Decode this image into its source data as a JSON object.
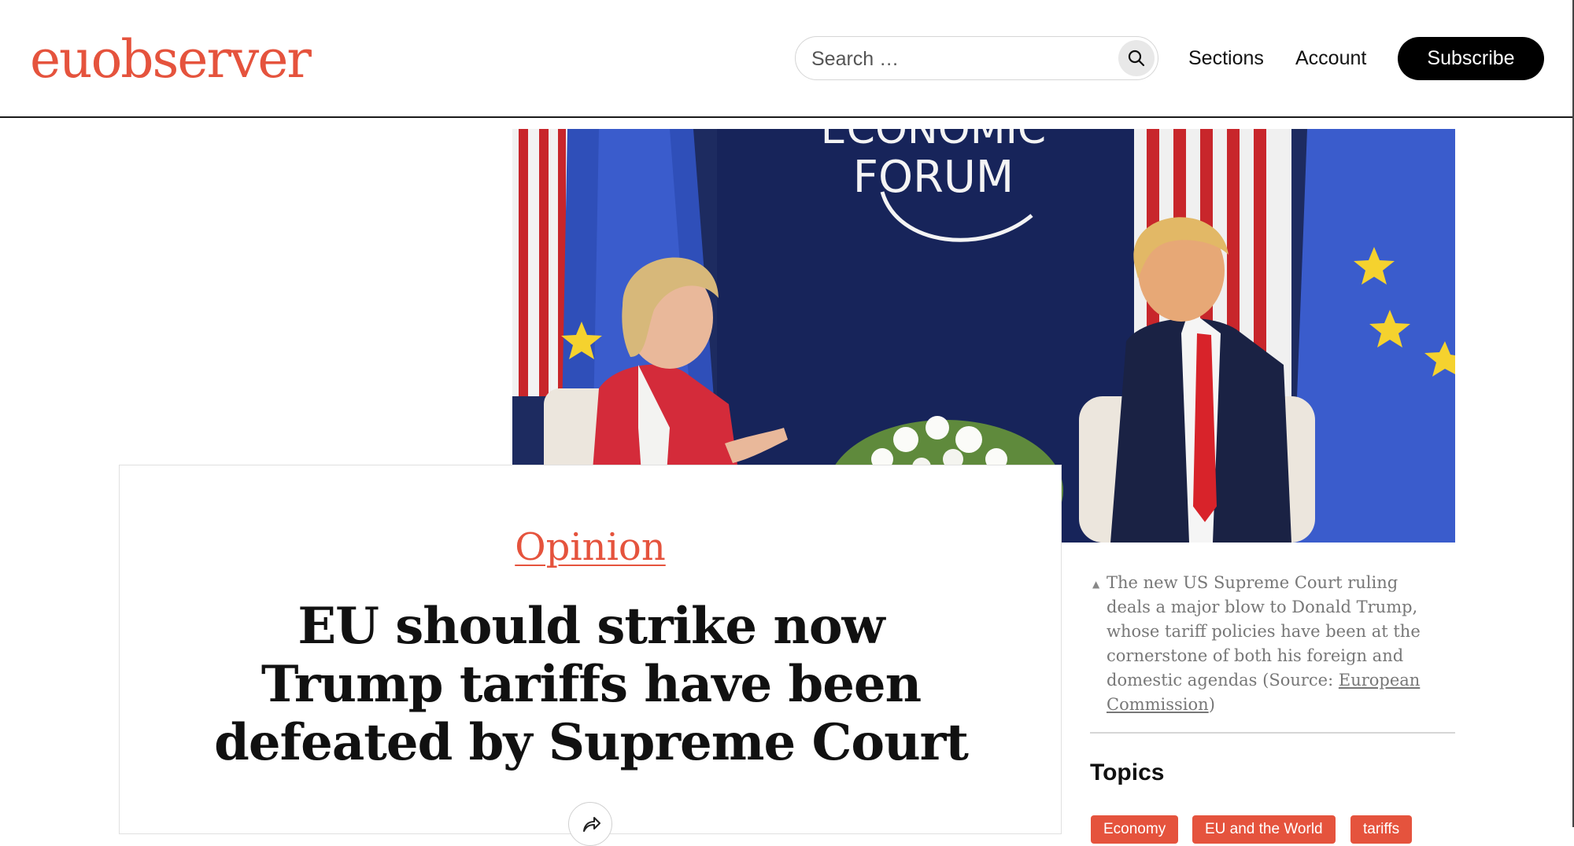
{
  "header": {
    "logo": "euobserver",
    "search_placeholder": "Search …",
    "nav": {
      "sections": "Sections",
      "account": "Account"
    },
    "subscribe_label": "Subscribe"
  },
  "hero": {
    "backdrop_text": [
      "ECONOMIC",
      "FORUM"
    ]
  },
  "article": {
    "category": "Opinion",
    "headline": "EU should strike now Trump tariffs have been defeated by Supreme Court",
    "caption": "The new US Supreme Court ruling deals a major blow to Donald Trump, whose tariff policies have been at the cornerstone of both his foreign and domestic agendas (Source: ",
    "caption_link": "European Commission",
    "caption_end": ")"
  },
  "topics": {
    "title": "Topics",
    "tags": [
      "Economy",
      "EU and the World",
      "tariffs"
    ]
  },
  "colors": {
    "brand": "#e5533d",
    "subscribe_bg": "#000000"
  },
  "icons": {
    "search": "search-icon",
    "share": "share-icon"
  }
}
